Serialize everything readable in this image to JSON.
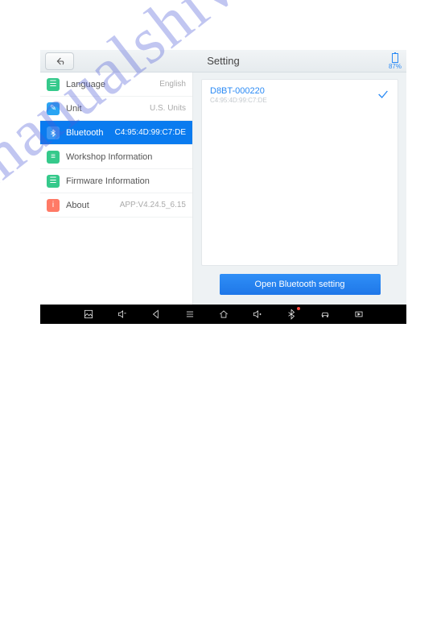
{
  "header": {
    "title": "Setting",
    "battery_pct": "87%"
  },
  "sidebar": {
    "items": [
      {
        "icon": "globe",
        "icon_bg": "#35c98b",
        "label": "Language",
        "value": "English"
      },
      {
        "icon": "ruler",
        "icon_bg": "#2aa5f3",
        "label": "Unit",
        "value": "U.S. Units"
      },
      {
        "icon": "bt",
        "icon_bg": "#0a7bef",
        "label": "Bluetooth",
        "value": "C4:95:4D:99:C7:DE",
        "active": true
      },
      {
        "icon": "shop",
        "icon_bg": "#35c98b",
        "label": "Workshop Information",
        "value": ""
      },
      {
        "icon": "chip",
        "icon_bg": "#35c98b",
        "label": "Firmware Information",
        "value": ""
      },
      {
        "icon": "info",
        "icon_bg": "#ff7a66",
        "label": "About",
        "value": "APP:V4.24.5_6.15"
      }
    ]
  },
  "devices": [
    {
      "name": "D8BT-000220",
      "mac": "C4:95:4D:99:C7:DE",
      "connected": true
    }
  ],
  "buttons": {
    "open_bt": "Open Bluetooth setting"
  },
  "watermark": "manualshive.com"
}
